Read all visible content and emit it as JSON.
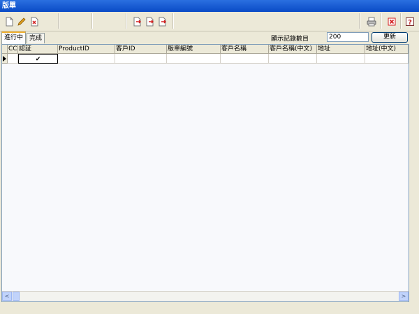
{
  "window": {
    "title": "版單"
  },
  "toolbar": {
    "left": [
      "new-document-icon",
      "edit-pencil-icon",
      "delete-icon"
    ],
    "middle": [
      "export-arrow-icon",
      "export-arrow-icon",
      "export-arrow-icon"
    ],
    "right": [
      "print-icon",
      "close-icon",
      "help-icon"
    ],
    "colors": {
      "pencil": "#e0a020",
      "delete": "#d21e1e",
      "arrow": "#d21e1e",
      "help": "#c02020"
    }
  },
  "tabs": [
    {
      "label": "進行中",
      "active": true
    },
    {
      "label": "完成",
      "active": false
    }
  ],
  "display": {
    "label": "顯示記錄數目",
    "value": "200",
    "button_label": "更新"
  },
  "grid": {
    "columns": [
      "CC",
      "認証",
      "ProductID",
      "客戶ID",
      "版單編號",
      "客戶名稱",
      "客戶名稱(中文)",
      "地址",
      "地址(中文)"
    ],
    "rows": [
      {
        "cells": [
          "",
          "✔",
          "",
          "",
          "",
          "",
          "",
          "",
          ""
        ]
      }
    ]
  },
  "scrollbar": {
    "left_arrow": "<",
    "right_arrow": ">"
  }
}
